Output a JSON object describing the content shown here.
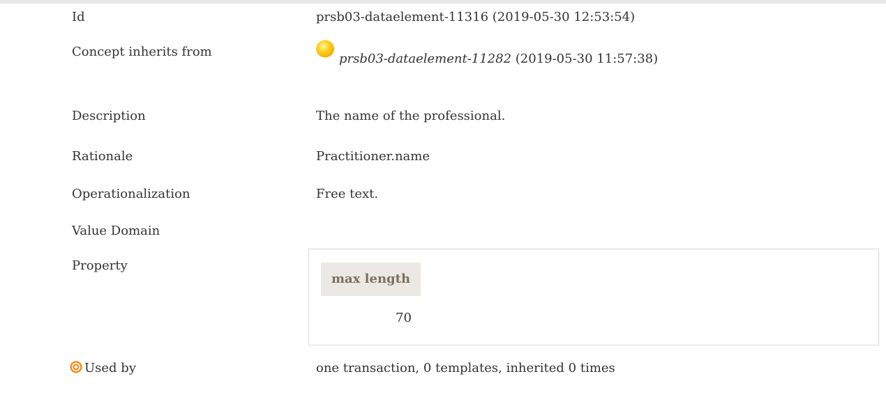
{
  "rows": [
    {
      "label": "Id",
      "value": "prsb03-dataelement-11316 (2019-05-30 12:53:54)"
    },
    {
      "label": "Concept inherits from",
      "ref_id": "prsb03-dataelement-11282",
      "ref_date": " (2019-05-30 11:57:38)",
      "icon": "yellow-ball-icon"
    },
    {
      "label": "Description",
      "value": "The name of the professional."
    },
    {
      "label": "Rationale",
      "value": "Practitioner.name"
    },
    {
      "label": "Operationalization",
      "value": "Free text."
    },
    {
      "label": "Value Domain",
      "value": ""
    },
    {
      "label": "Property"
    },
    {
      "label": "Used by",
      "value": "one transaction, 0 templates, inherited 0 times",
      "icon": "target-icon"
    }
  ],
  "property": {
    "header": "max length",
    "value": "70"
  },
  "colors": {
    "text": "#333333",
    "property_header_bg": "#ece8e3",
    "property_header_text": "#7a6f62",
    "box_border": "#d9d9d9",
    "ball": "#ffc000",
    "target": "#ff7f00"
  }
}
